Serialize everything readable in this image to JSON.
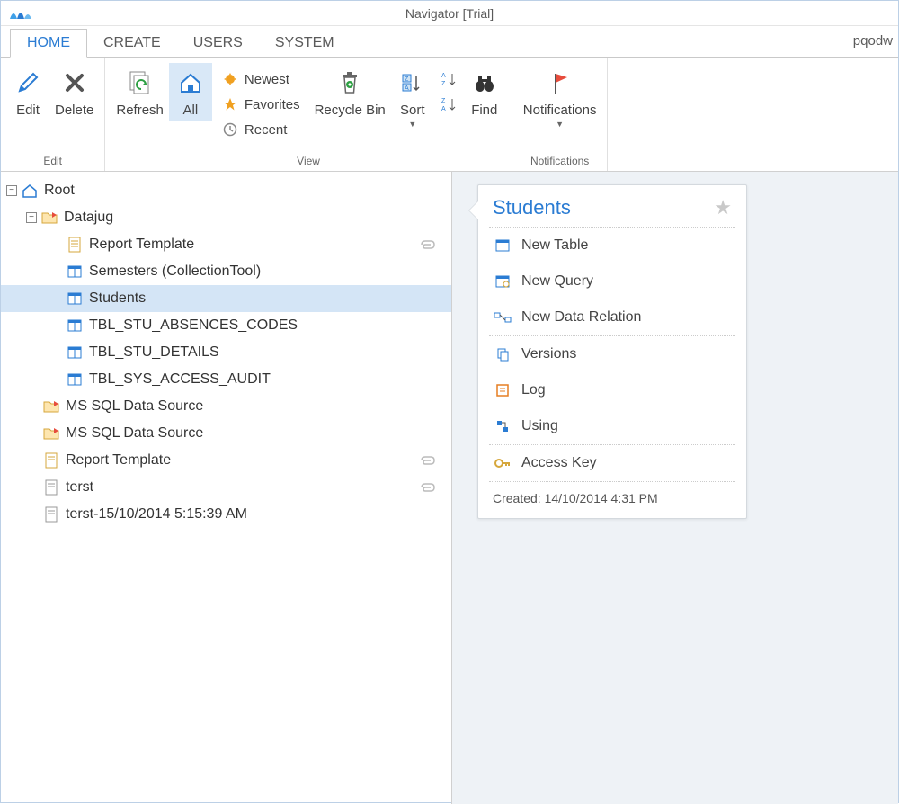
{
  "window": {
    "title": "Navigator [Trial]",
    "username": "pqodw"
  },
  "tabs": {
    "home": "HOME",
    "create": "CREATE",
    "users": "USERS",
    "system": "SYSTEM"
  },
  "ribbon": {
    "edit": {
      "edit": "Edit",
      "delete": "Delete",
      "group_label": "Edit"
    },
    "view": {
      "refresh": "Refresh",
      "all": "All",
      "newest": "Newest",
      "favorites": "Favorites",
      "recent": "Recent",
      "recycle": "Recycle Bin",
      "sort": "Sort",
      "find": "Find",
      "group_label": "View"
    },
    "notifications": {
      "notifications": "Notifications",
      "group_label": "Notifications"
    }
  },
  "tree": {
    "root": "Root",
    "datajug": "Datajug",
    "items": [
      {
        "label": "Report Template",
        "type": "report",
        "attach": true
      },
      {
        "label": "Semesters (CollectionTool)",
        "type": "table"
      },
      {
        "label": "Students",
        "type": "table",
        "selected": true
      },
      {
        "label": "TBL_STU_ABSENCES_CODES",
        "type": "table"
      },
      {
        "label": "TBL_STU_DETAILS",
        "type": "table"
      },
      {
        "label": "TBL_SYS_ACCESS_AUDIT",
        "type": "table"
      }
    ],
    "ds1": "MS SQL Data Source",
    "ds2": "MS SQL Data Source",
    "rt2": "Report Template",
    "terst": "terst",
    "terst_ts": "terst-15/10/2014 5:15:39 AM"
  },
  "card": {
    "title": "Students",
    "new_table": "New Table",
    "new_query": "New Query",
    "new_relation": "New Data Relation",
    "versions": "Versions",
    "log": "Log",
    "using": "Using",
    "access_key": "Access Key",
    "created": "Created: 14/10/2014 4:31 PM"
  }
}
